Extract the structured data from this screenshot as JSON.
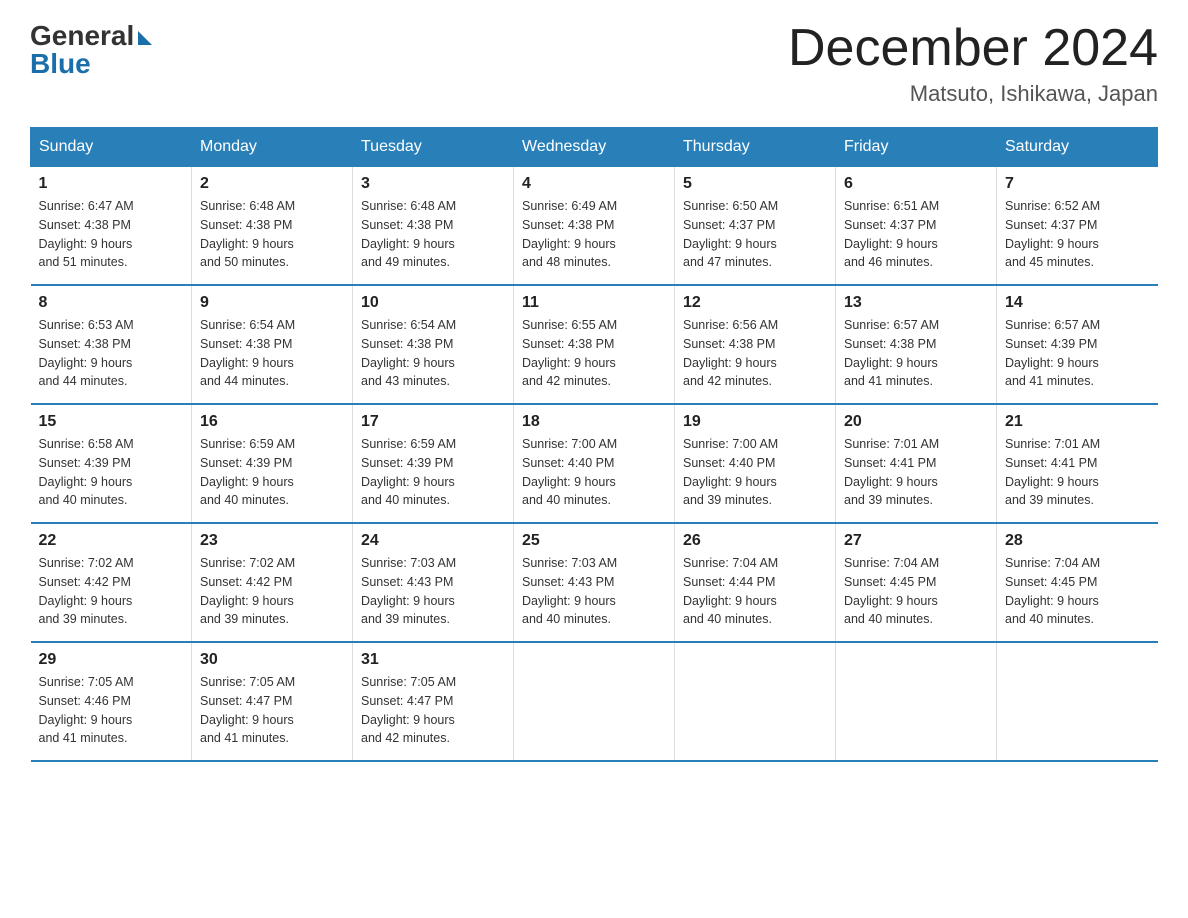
{
  "header": {
    "logo_general": "General",
    "logo_blue": "Blue",
    "month_title": "December 2024",
    "location": "Matsuto, Ishikawa, Japan"
  },
  "days_of_week": [
    "Sunday",
    "Monday",
    "Tuesday",
    "Wednesday",
    "Thursday",
    "Friday",
    "Saturday"
  ],
  "weeks": [
    [
      {
        "num": "1",
        "sunrise": "6:47 AM",
        "sunset": "4:38 PM",
        "daylight": "9 hours and 51 minutes."
      },
      {
        "num": "2",
        "sunrise": "6:48 AM",
        "sunset": "4:38 PM",
        "daylight": "9 hours and 50 minutes."
      },
      {
        "num": "3",
        "sunrise": "6:48 AM",
        "sunset": "4:38 PM",
        "daylight": "9 hours and 49 minutes."
      },
      {
        "num": "4",
        "sunrise": "6:49 AM",
        "sunset": "4:38 PM",
        "daylight": "9 hours and 48 minutes."
      },
      {
        "num": "5",
        "sunrise": "6:50 AM",
        "sunset": "4:37 PM",
        "daylight": "9 hours and 47 minutes."
      },
      {
        "num": "6",
        "sunrise": "6:51 AM",
        "sunset": "4:37 PM",
        "daylight": "9 hours and 46 minutes."
      },
      {
        "num": "7",
        "sunrise": "6:52 AM",
        "sunset": "4:37 PM",
        "daylight": "9 hours and 45 minutes."
      }
    ],
    [
      {
        "num": "8",
        "sunrise": "6:53 AM",
        "sunset": "4:38 PM",
        "daylight": "9 hours and 44 minutes."
      },
      {
        "num": "9",
        "sunrise": "6:54 AM",
        "sunset": "4:38 PM",
        "daylight": "9 hours and 44 minutes."
      },
      {
        "num": "10",
        "sunrise": "6:54 AM",
        "sunset": "4:38 PM",
        "daylight": "9 hours and 43 minutes."
      },
      {
        "num": "11",
        "sunrise": "6:55 AM",
        "sunset": "4:38 PM",
        "daylight": "9 hours and 42 minutes."
      },
      {
        "num": "12",
        "sunrise": "6:56 AM",
        "sunset": "4:38 PM",
        "daylight": "9 hours and 42 minutes."
      },
      {
        "num": "13",
        "sunrise": "6:57 AM",
        "sunset": "4:38 PM",
        "daylight": "9 hours and 41 minutes."
      },
      {
        "num": "14",
        "sunrise": "6:57 AM",
        "sunset": "4:39 PM",
        "daylight": "9 hours and 41 minutes."
      }
    ],
    [
      {
        "num": "15",
        "sunrise": "6:58 AM",
        "sunset": "4:39 PM",
        "daylight": "9 hours and 40 minutes."
      },
      {
        "num": "16",
        "sunrise": "6:59 AM",
        "sunset": "4:39 PM",
        "daylight": "9 hours and 40 minutes."
      },
      {
        "num": "17",
        "sunrise": "6:59 AM",
        "sunset": "4:39 PM",
        "daylight": "9 hours and 40 minutes."
      },
      {
        "num": "18",
        "sunrise": "7:00 AM",
        "sunset": "4:40 PM",
        "daylight": "9 hours and 40 minutes."
      },
      {
        "num": "19",
        "sunrise": "7:00 AM",
        "sunset": "4:40 PM",
        "daylight": "9 hours and 39 minutes."
      },
      {
        "num": "20",
        "sunrise": "7:01 AM",
        "sunset": "4:41 PM",
        "daylight": "9 hours and 39 minutes."
      },
      {
        "num": "21",
        "sunrise": "7:01 AM",
        "sunset": "4:41 PM",
        "daylight": "9 hours and 39 minutes."
      }
    ],
    [
      {
        "num": "22",
        "sunrise": "7:02 AM",
        "sunset": "4:42 PM",
        "daylight": "9 hours and 39 minutes."
      },
      {
        "num": "23",
        "sunrise": "7:02 AM",
        "sunset": "4:42 PM",
        "daylight": "9 hours and 39 minutes."
      },
      {
        "num": "24",
        "sunrise": "7:03 AM",
        "sunset": "4:43 PM",
        "daylight": "9 hours and 39 minutes."
      },
      {
        "num": "25",
        "sunrise": "7:03 AM",
        "sunset": "4:43 PM",
        "daylight": "9 hours and 40 minutes."
      },
      {
        "num": "26",
        "sunrise": "7:04 AM",
        "sunset": "4:44 PM",
        "daylight": "9 hours and 40 minutes."
      },
      {
        "num": "27",
        "sunrise": "7:04 AM",
        "sunset": "4:45 PM",
        "daylight": "9 hours and 40 minutes."
      },
      {
        "num": "28",
        "sunrise": "7:04 AM",
        "sunset": "4:45 PM",
        "daylight": "9 hours and 40 minutes."
      }
    ],
    [
      {
        "num": "29",
        "sunrise": "7:05 AM",
        "sunset": "4:46 PM",
        "daylight": "9 hours and 41 minutes."
      },
      {
        "num": "30",
        "sunrise": "7:05 AM",
        "sunset": "4:47 PM",
        "daylight": "9 hours and 41 minutes."
      },
      {
        "num": "31",
        "sunrise": "7:05 AM",
        "sunset": "4:47 PM",
        "daylight": "9 hours and 42 minutes."
      },
      null,
      null,
      null,
      null
    ]
  ],
  "sunrise_label": "Sunrise:",
  "sunset_label": "Sunset:",
  "daylight_label": "Daylight:"
}
